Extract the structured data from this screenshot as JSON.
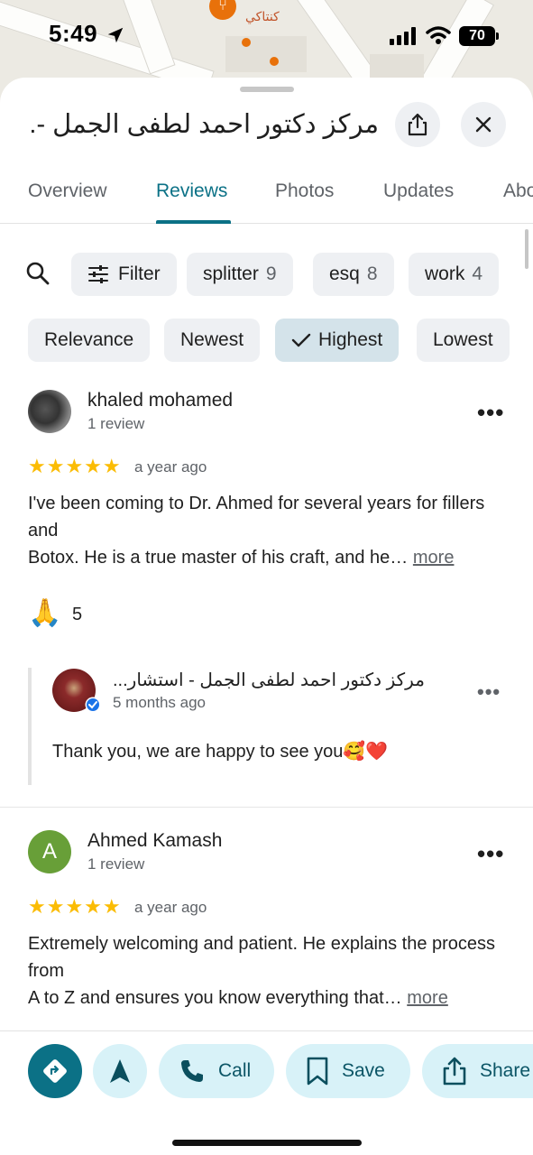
{
  "status_bar": {
    "time": "5:49",
    "battery": "70"
  },
  "map": {
    "poi_label": "كنتاكي"
  },
  "place": {
    "title": "مركز دكتور احمد لطفى الجمل -..."
  },
  "tabs": [
    {
      "label": "Overview"
    },
    {
      "label": "Reviews"
    },
    {
      "label": "Photos"
    },
    {
      "label": "Updates"
    },
    {
      "label": "Abo"
    }
  ],
  "filters": {
    "filter_label": "Filter",
    "topics": [
      {
        "label": "splitter",
        "count": "9"
      },
      {
        "label": "esq",
        "count": "8"
      },
      {
        "label": "work",
        "count": "4"
      }
    ],
    "sort": [
      {
        "label": "Relevance"
      },
      {
        "label": "Newest"
      },
      {
        "label": "Highest",
        "selected": true
      },
      {
        "label": "Lowest"
      }
    ]
  },
  "reviews": [
    {
      "name": "khaled mohamed",
      "sub": "1 review",
      "stars": "★★★★★",
      "time": "a year ago",
      "text": "I've been coming to Dr. Ahmed for several years for fillers and\nBotox. He is a true master of his craft, and he…",
      "more": "more",
      "reaction_emoji": "🙏",
      "reaction_count": "5",
      "owner_reply": {
        "name": "مركز دكتور احمد لطفى الجمل - استشار...",
        "time": "5 months ago",
        "text": "Thank you, we are happy to see you🥰❤️"
      }
    },
    {
      "name": "Ahmed Kamash",
      "initial": "A",
      "sub": "1 review",
      "stars": "★★★★★",
      "time": "a year ago",
      "text": "Extremely welcoming and patient. He explains the process from\nA to Z and ensures you know everything that…",
      "more": "more"
    }
  ],
  "actions": {
    "call": "Call",
    "save": "Save",
    "share": "Share"
  },
  "colors": {
    "accent": "#0b7186",
    "star": "#fbbc04",
    "chip_bg": "#eef0f3",
    "action_bg": "#d8f2f8"
  }
}
